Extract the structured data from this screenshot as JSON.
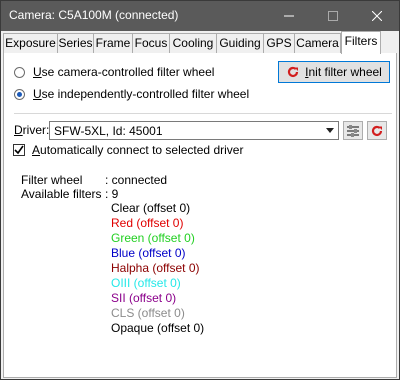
{
  "window": {
    "title": "Camera: C5A100M (connected)"
  },
  "tabs": [
    {
      "label": "Exposure"
    },
    {
      "label": "Series"
    },
    {
      "label": "Frame"
    },
    {
      "label": "Focus"
    },
    {
      "label": "Cooling"
    },
    {
      "label": "Guiding"
    },
    {
      "label": "GPS"
    },
    {
      "label": "Camera"
    },
    {
      "label": "Filters",
      "active": true
    }
  ],
  "mode": {
    "camera_controlled": {
      "accel": "U",
      "rest": "se camera-controlled filter wheel",
      "selected": false
    },
    "independent": {
      "accel": "U",
      "rest": "se independently-controlled filter wheel",
      "selected": true
    }
  },
  "init_button": {
    "accel": "I",
    "rest": "nit filter wheel"
  },
  "driver": {
    "label_accel": "D",
    "label_rest": "river:",
    "value": "SFW-5XL, Id: 45001"
  },
  "auto_connect": {
    "accel": "A",
    "rest": "utomatically connect to selected driver",
    "checked": true
  },
  "status": {
    "filter_wheel_label": "Filter wheel",
    "filter_wheel_value": ": connected",
    "available_label": "Available filters",
    "available_value": ": 9"
  },
  "filters": [
    {
      "text": "Clear (offset 0)",
      "color": "#000000"
    },
    {
      "text": "Red (offset 0)",
      "color": "#e00000"
    },
    {
      "text": "Green (offset 0)",
      "color": "#22d022"
    },
    {
      "text": "Blue (offset 0)",
      "color": "#0000c8"
    },
    {
      "text": "Halpha (offset 0)",
      "color": "#8b0000"
    },
    {
      "text": "OIII (offset 0)",
      "color": "#25e8e8"
    },
    {
      "text": "SII (offset 0)",
      "color": "#8b008b"
    },
    {
      "text": "CLS (offset 0)",
      "color": "#8c8c8c"
    },
    {
      "text": "Opaque (offset 0)",
      "color": "#000000"
    }
  ],
  "icons": {
    "refresh": "refresh-icon",
    "settings": "settings-icon",
    "dropdown": "chevron-down-icon"
  }
}
